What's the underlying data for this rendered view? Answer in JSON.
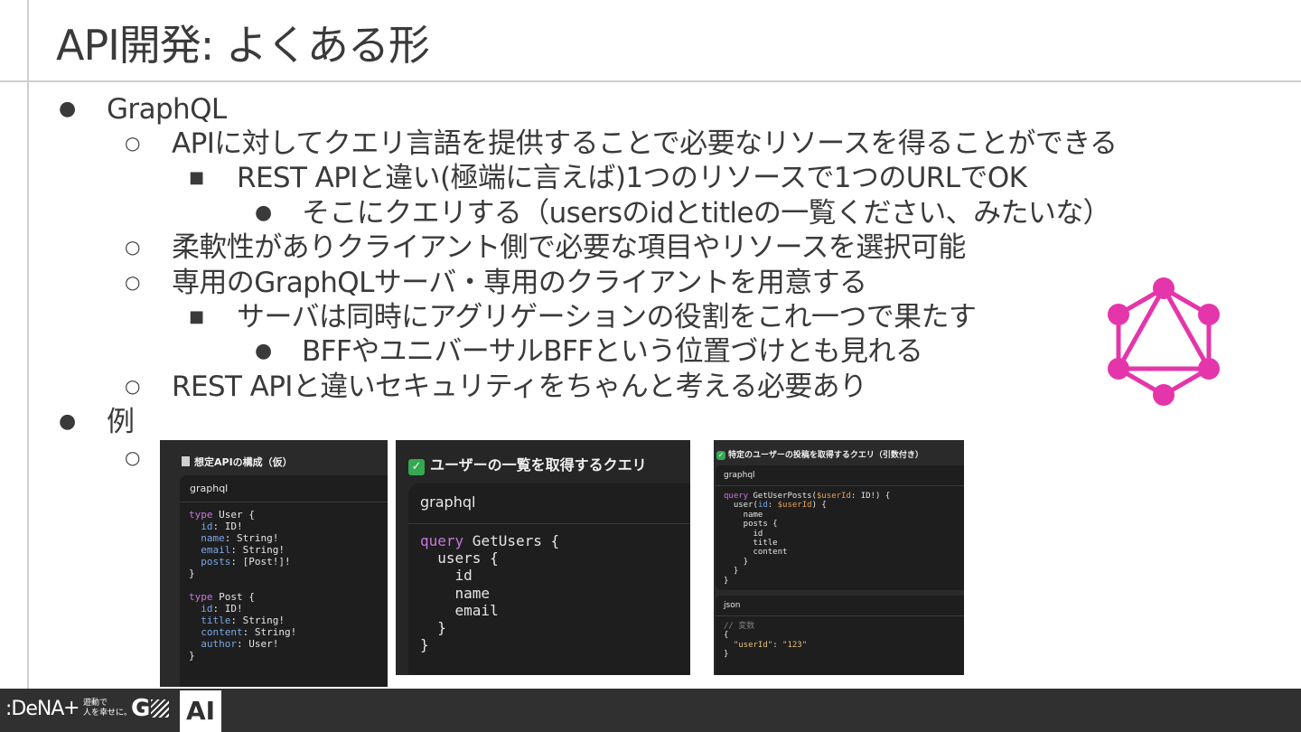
{
  "slide": {
    "title": "API開発: よくある形"
  },
  "bullets": [
    {
      "level": 1,
      "text": "GraphQL"
    },
    {
      "level": 2,
      "text": "APIに対してクエリ言語を提供することで必要なリソースを得ることができる"
    },
    {
      "level": 3,
      "text": "REST APIと違い(極端に言えば)1つのリソースで1つのURLでOK"
    },
    {
      "level": 4,
      "text": "そこにクエリする（usersのidとtitleの一覧ください、みたいな）"
    },
    {
      "level": 2,
      "text": "柔軟性がありクライアント側で必要な項目やリソースを選択可能"
    },
    {
      "level": 2,
      "text": "専用のGraphQLサーバ・専用のクライアントを用意する"
    },
    {
      "level": 3,
      "text": "サーバは同時にアグリゲーションの役割をこれ一つで果たす"
    },
    {
      "level": 4,
      "text": "BFFやユニバーサルBFFという位置づけとも見れる"
    },
    {
      "level": 2,
      "text": "REST APIと違いセキュリティをちゃんと考える必要あり"
    },
    {
      "level": 1,
      "text": "例"
    },
    {
      "level": 2,
      "text": ""
    }
  ],
  "screenshots": {
    "schema": {
      "header": "想定APIの構成（仮）",
      "header_icon": "memo-icon",
      "lang": "graphql"
    },
    "users_query": {
      "header": "ユーザーの一覧を取得するクエリ",
      "header_icon": "check-mark-icon",
      "lang": "graphql"
    },
    "posts_query": {
      "header": "特定のユーザーの投稿を取得するクエリ（引数付き）",
      "header_icon": "check-mark-icon",
      "lang": "graphql",
      "vars_lang": "json"
    }
  },
  "footer": {
    "brand": "DeNA",
    "plus": "+",
    "tagline_line1": "遊動で",
    "tagline_line2": "人を幸せに。",
    "mark": "G",
    "badge": "AI"
  },
  "colors": {
    "graphql_logo": "#e535ab",
    "footer_bg": "#303030",
    "code_keyword": "#c678dd",
    "code_field": "#7aa7e8",
    "code_variable": "#e5a05a"
  }
}
